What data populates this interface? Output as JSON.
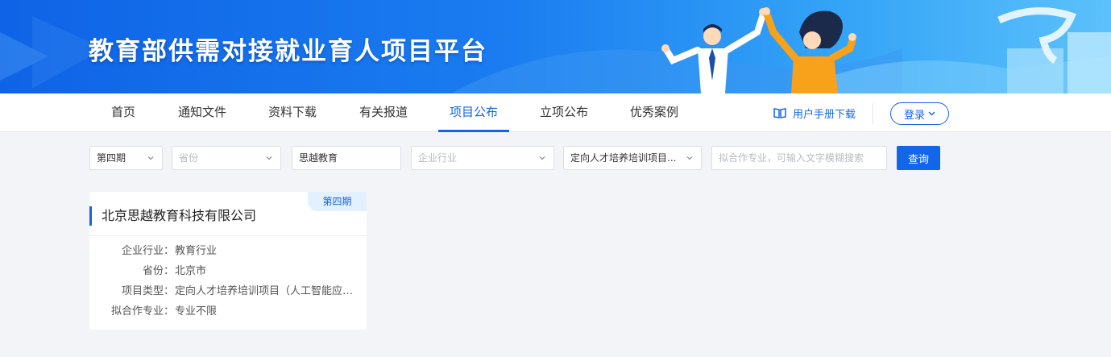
{
  "banner": {
    "title": "教育部供需对接就业育人项目平台"
  },
  "nav": {
    "items": [
      {
        "label": "首页"
      },
      {
        "label": "通知文件"
      },
      {
        "label": "资料下载"
      },
      {
        "label": "有关报道"
      },
      {
        "label": "项目公布"
      },
      {
        "label": "立项公布"
      },
      {
        "label": "优秀案例"
      }
    ],
    "active": "项目公布",
    "manual_label": "用户手册下载",
    "login_label": "登录"
  },
  "filters": {
    "period": "第四期",
    "province_placeholder": "省份",
    "company_value": "思越教育",
    "industry_placeholder": "企业行业",
    "project_type": "定向人才培养培训项目...",
    "major_placeholder": "拟合作专业，可输入文字模糊搜索",
    "query_label": "查询"
  },
  "results": [
    {
      "tag": "第四期",
      "company": "北京思越教育科技有限公司",
      "rows": [
        {
          "label": "企业行业",
          "value": "教育行业"
        },
        {
          "label": "省份",
          "value": "北京市"
        },
        {
          "label": "项目类型",
          "value": "定向人才培养培训项目（人工智能应用..."
        },
        {
          "label": "拟合作专业",
          "value": "专业不限"
        }
      ]
    }
  ],
  "colors": {
    "primary": "#1366e8",
    "page_bg": "#f2f4f8"
  }
}
